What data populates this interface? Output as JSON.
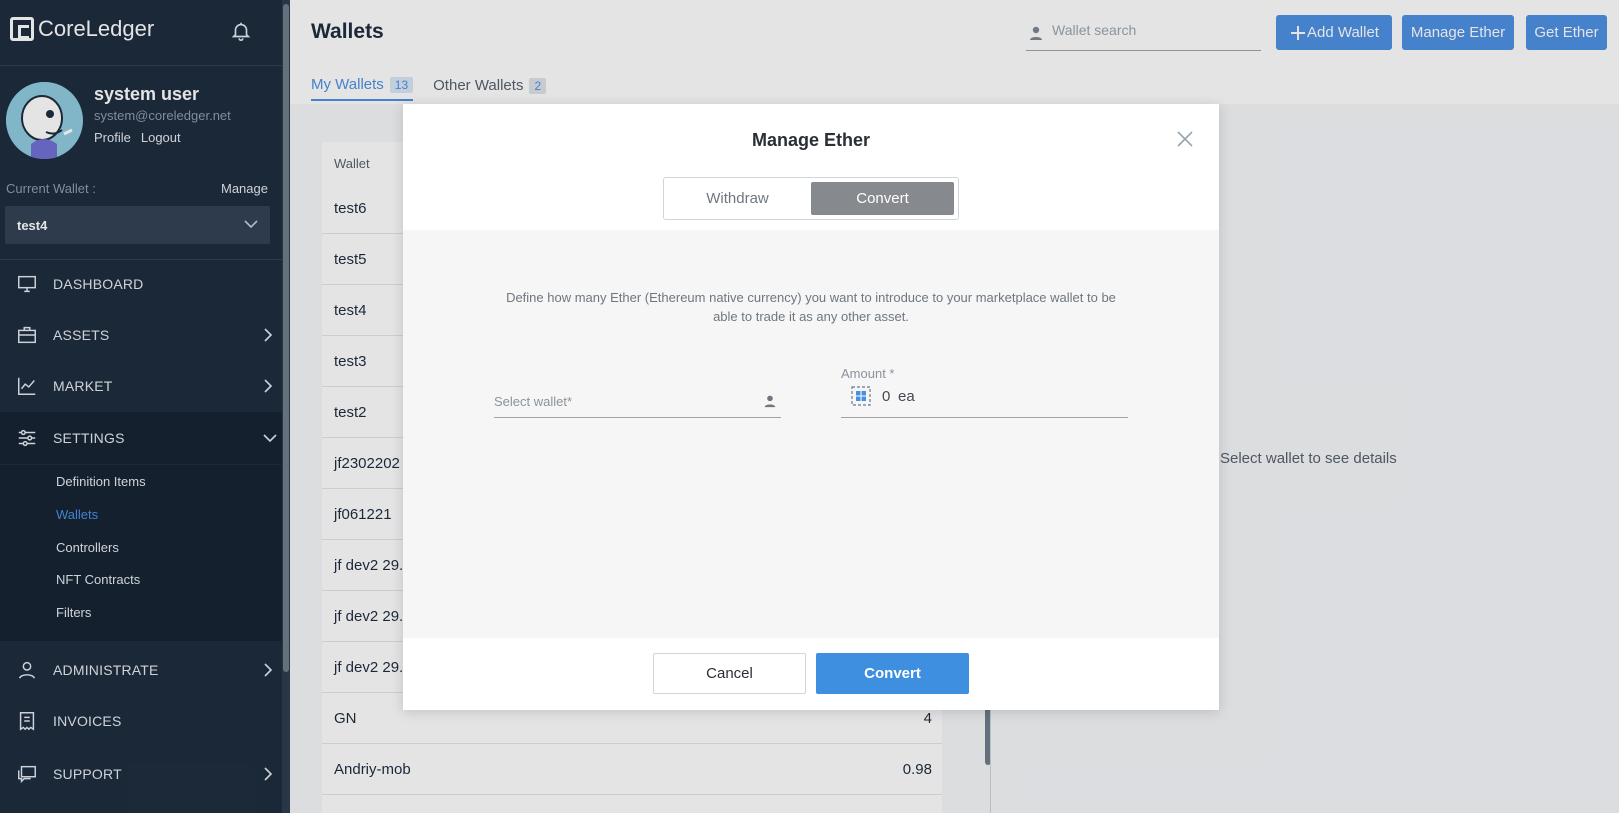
{
  "brand": {
    "name": "CoreLedger"
  },
  "user": {
    "name": "system user",
    "email": "system@coreledger.net",
    "profile_label": "Profile",
    "logout_label": "Logout"
  },
  "current_wallet": {
    "label": "Current Wallet :",
    "manage_label": "Manage",
    "selected": "test4"
  },
  "nav": {
    "dashboard": "DASHBOARD",
    "assets": "ASSETS",
    "market": "MARKET",
    "settings": "SETTINGS",
    "settings_items": [
      "Definition Items",
      "Wallets",
      "Controllers",
      "NFT Contracts",
      "Filters"
    ],
    "administrate": "ADMINISTRATE",
    "invoices": "INVOICES",
    "support": "SUPPORT"
  },
  "header": {
    "title": "Wallets",
    "search_placeholder": "Wallet search",
    "add_wallet": "Add Wallet",
    "manage_ether": "Manage Ether",
    "get_ether": "Get Ether"
  },
  "tabs": [
    {
      "label": "My Wallets",
      "count": "13"
    },
    {
      "label": "Other Wallets",
      "count": "2"
    }
  ],
  "table": {
    "header": "Wallet",
    "rows": [
      {
        "name": "test6",
        "value": ""
      },
      {
        "name": "test5",
        "value": ""
      },
      {
        "name": "test4",
        "value": ""
      },
      {
        "name": "test3",
        "value": ""
      },
      {
        "name": "test2",
        "value": ""
      },
      {
        "name": "jf2302202",
        "value": ""
      },
      {
        "name": "jf061221",
        "value": ""
      },
      {
        "name": "jf dev2 29.",
        "value": ""
      },
      {
        "name": "jf dev2 29.",
        "value": ""
      },
      {
        "name": "jf dev2 29.",
        "value": ""
      },
      {
        "name": "GN",
        "value": "4"
      },
      {
        "name": "Andriy-mob",
        "value": "0.98"
      }
    ]
  },
  "detail_hint": "Select wallet to see details",
  "modal": {
    "title": "Manage Ether",
    "options": [
      "Withdraw",
      "Convert"
    ],
    "selected_option": "Convert",
    "description": "Define how many Ether (Ethereum native currency) you want to introduce to your marketplace wallet to be able to trade it as any other asset.",
    "wallet_placeholder": "Select wallet*",
    "amount_label": "Amount *",
    "amount_value": "0",
    "amount_unit": "ea",
    "cancel_label": "Cancel",
    "convert_label": "Convert"
  },
  "colors": {
    "sidebar": "#1b2a3b",
    "accent": "#4a90e2",
    "selected_toggle": "#86898d"
  }
}
